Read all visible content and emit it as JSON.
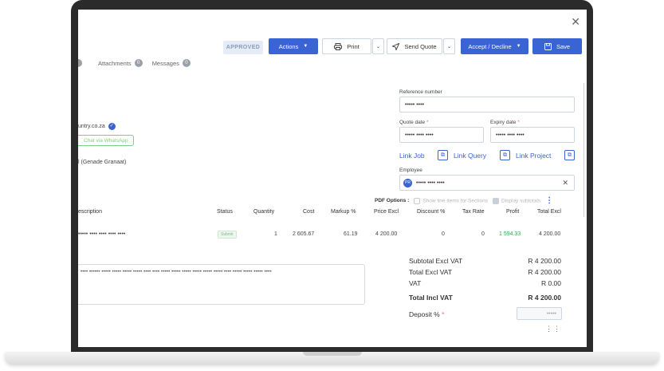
{
  "header": {
    "status_badge": "APPROVED",
    "actions_label": "Actions",
    "print_label": "Print",
    "send_quote_label": "Send Quote",
    "accept_decline_label": "Accept / Decline",
    "save_label": "Save"
  },
  "tabs": [
    {
      "label": "Attachments",
      "count": "0"
    },
    {
      "label": "Messages",
      "count": "0"
    }
  ],
  "customer": {
    "email_fragment": "untry.co.za",
    "whatsapp_label": "Chat via WhatsApp",
    "contact_fragment": "l (Genade Granaat)"
  },
  "form": {
    "reference_label": "Reference number",
    "reference_value": "••••• ••••",
    "quote_date_label": "Quote date",
    "quote_date_value": "••••• •••• ••••",
    "expiry_date_label": "Expiry date",
    "expiry_date_value": "••••• •••• ••••",
    "link_job": "Link Job",
    "link_query": "Link Query",
    "link_project": "Link Project",
    "employee_label": "Employee",
    "employee_initials": "PR",
    "employee_value": "••••• •••• ••••"
  },
  "pdf_options": {
    "label": "PDF Options :",
    "show_line_items": "Show line items for Sections",
    "display_subtotals": "Display subtotals"
  },
  "table": {
    "headers": [
      "escription",
      "Status",
      "Quantity",
      "Cost",
      "Markup %",
      "Price Excl",
      "Discount %",
      "Tax Rate",
      "Profit",
      "Total Excl"
    ],
    "row": {
      "description": "••••• •••• •••• •••• ••••",
      "status": "Submit",
      "quantity": "1",
      "cost": "2 605.67",
      "markup": "61.19",
      "price_excl": "4 200.00",
      "discount": "0",
      "tax_rate": "0",
      "profit": "1 594.33",
      "total_excl": "4 200.00"
    }
  },
  "notes": {
    "text": "•••• •••••• ••••• ••••• ••••• ••••• •••• •••• ••••• ••••• ••••• ••••• ••••• ••••• •••• ••••• ••••• ••••• ••••"
  },
  "summary": {
    "subtotal_label": "Subtotal Excl VAT",
    "subtotal_value": "R 4 200.00",
    "total_excl_label": "Total Excl VAT",
    "total_excl_value": "R 4 200.00",
    "vat_label": "VAT",
    "vat_value": "R 0.00",
    "total_incl_label": "Total Incl VAT",
    "total_incl_value": "R 4 200.00",
    "deposit_label": "Deposit %",
    "deposit_value": "•••••"
  },
  "colors": {
    "primary": "#3a63d3",
    "profit_green": "#3aa34a",
    "badge_bg": "#e6ecf6"
  }
}
